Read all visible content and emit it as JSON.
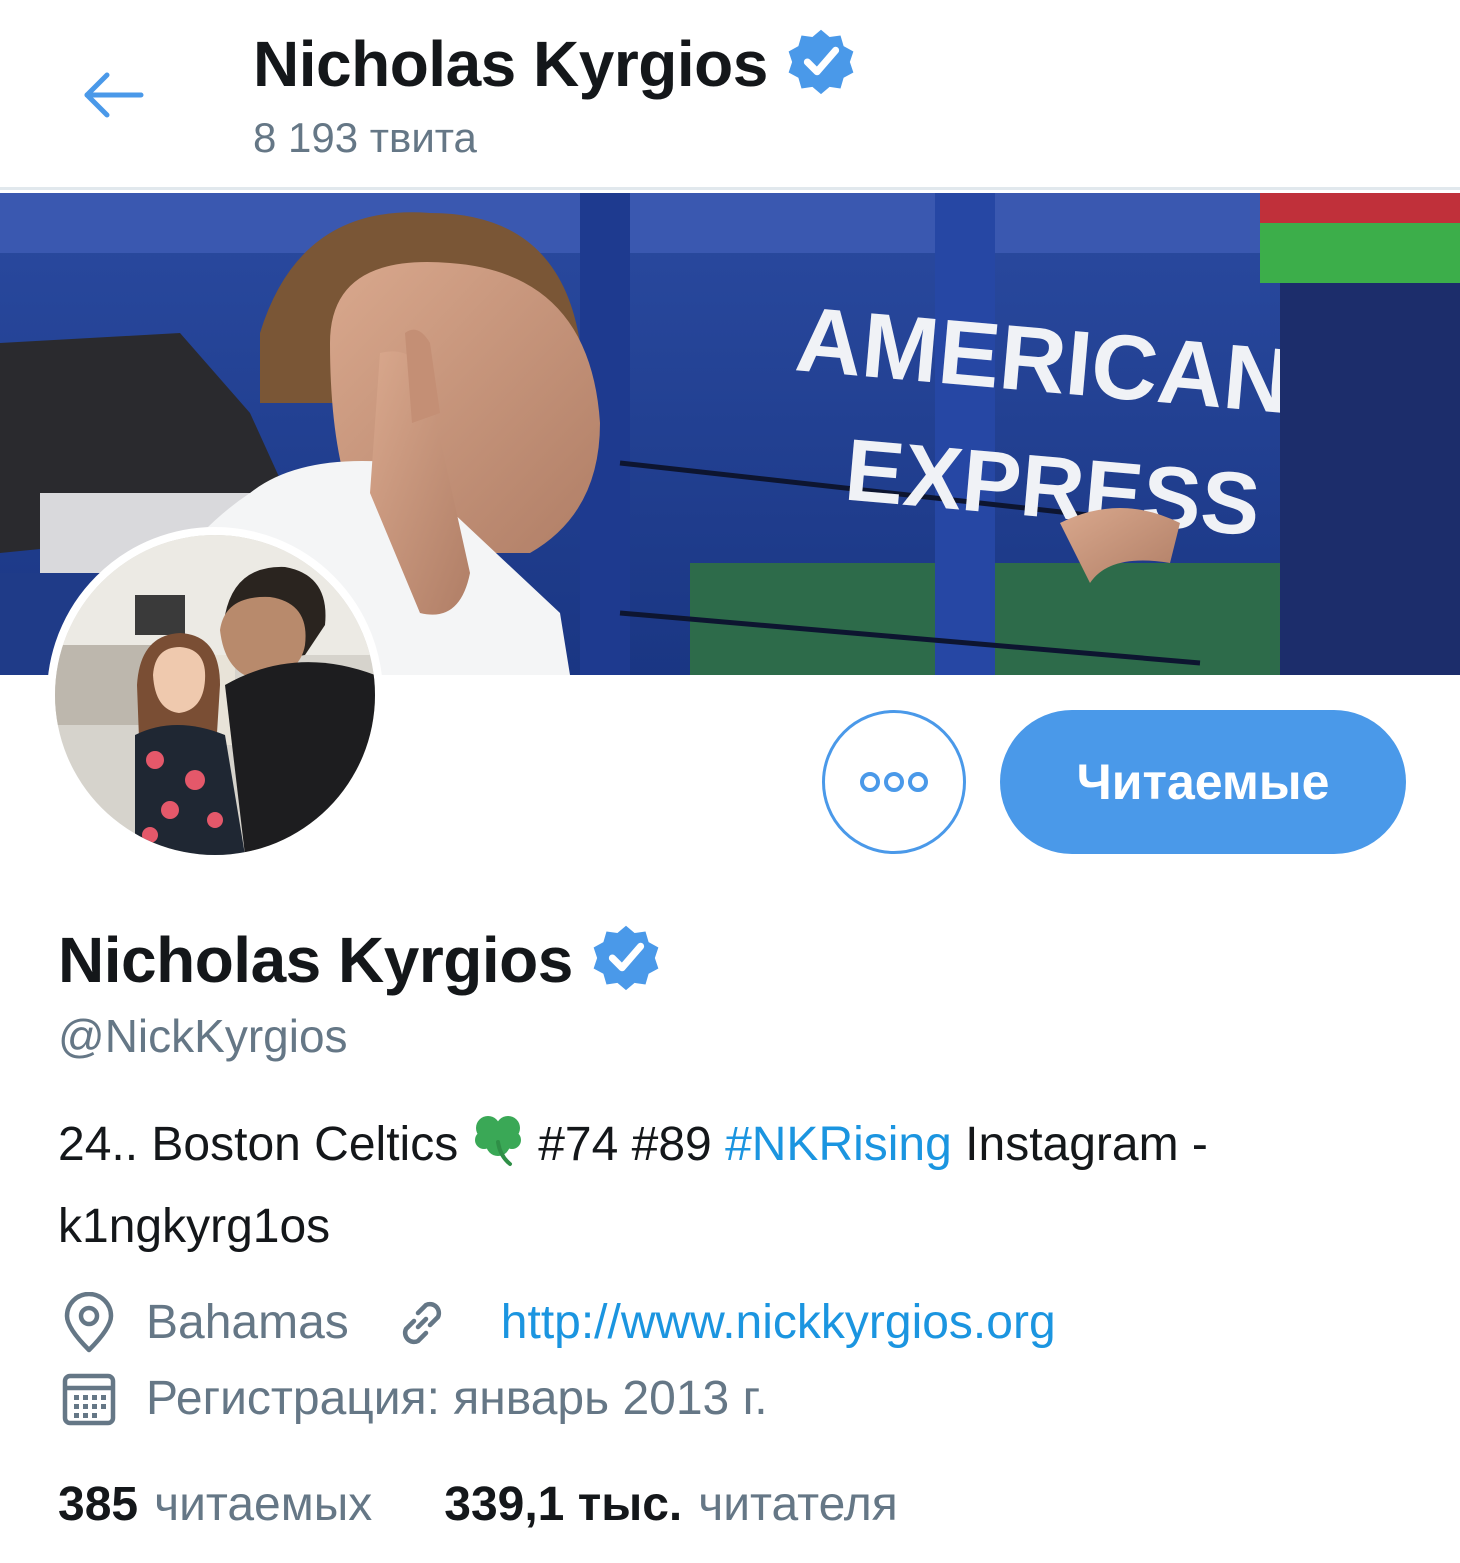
{
  "header": {
    "title": "Nicholas Kyrgios",
    "tweet_count": "8 193 твита",
    "back_icon": "arrow-left-icon",
    "verified_icon": "verified-badge-icon"
  },
  "banner": {
    "sign_line1": "AMERICAN",
    "sign_line2": "EXPRESS"
  },
  "actions": {
    "more_icon": "more-horizontal-icon",
    "follow_label": "Читаемые"
  },
  "profile": {
    "name": "Nicholas Kyrgios",
    "handle": "@NickKyrgios",
    "bio_part1": "24.. Boston Celtics",
    "bio_clover": "shamrock-icon",
    "bio_part2": "#74 #89",
    "bio_hashtag": "#NKRising",
    "bio_part3": "Instagram - k1ngkyrg1os",
    "location": "Bahamas",
    "url": "http://www.nickkyrgios.org",
    "joined": "Регистрация: январь 2013 г."
  },
  "stats": {
    "following_count": "385",
    "following_label": "читаемых",
    "followers_count": "339,1 тыс.",
    "followers_label": "читателя"
  },
  "colors": {
    "accent": "#4a99e9",
    "link": "#1b95e0",
    "secondary_text": "#657786",
    "primary_text": "#14171a"
  }
}
